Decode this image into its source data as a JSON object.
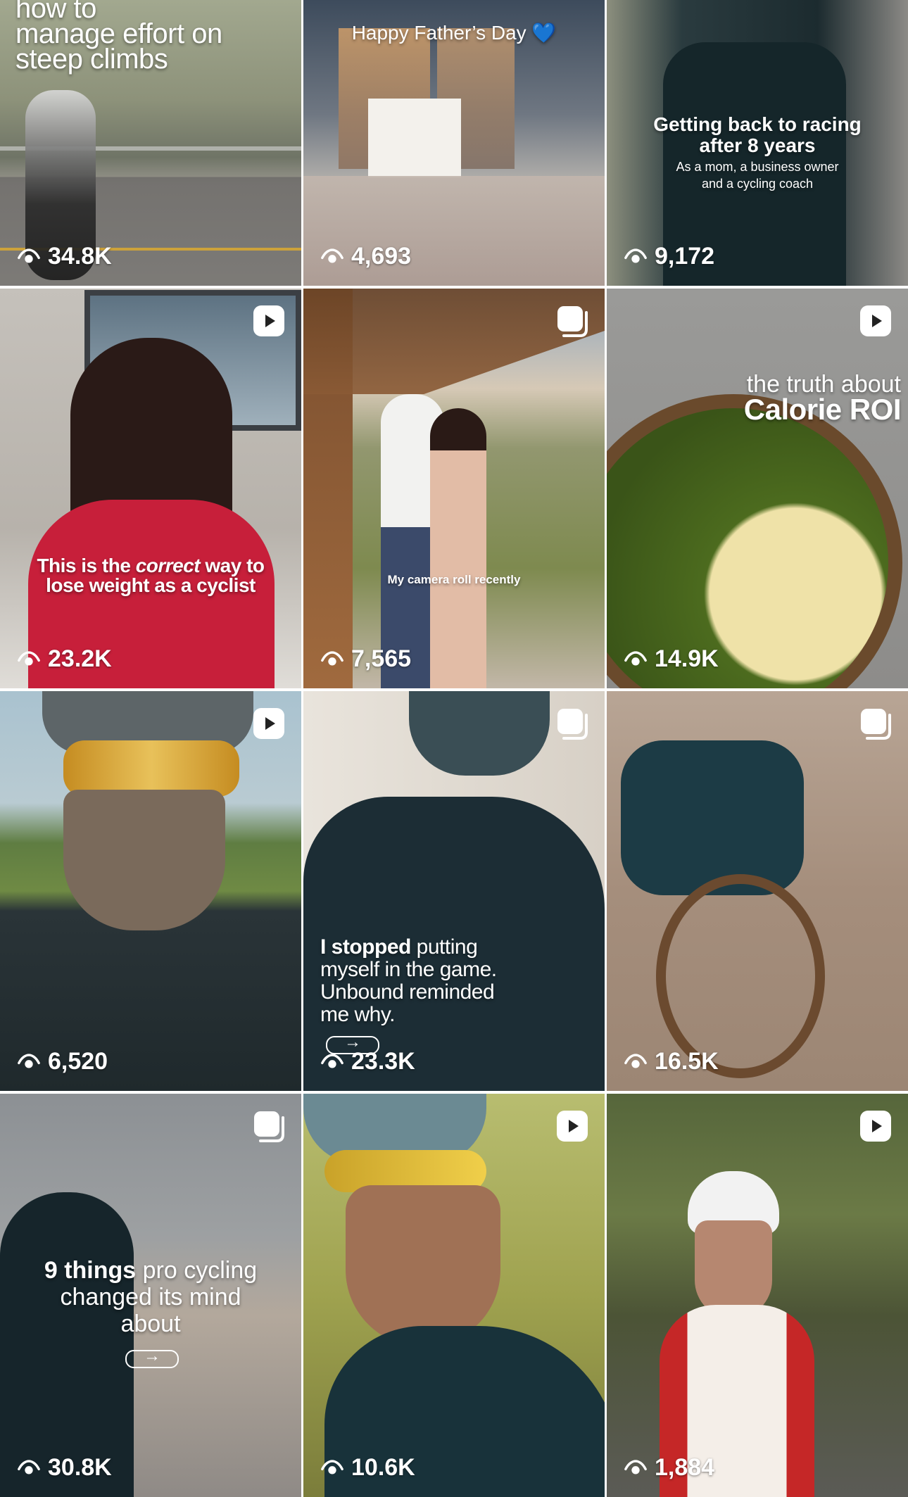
{
  "tiles": [
    {
      "views": "34.8K",
      "caption": {
        "line1": "how to",
        "line2": "manage effort on",
        "line3": "steep climbs"
      },
      "badge": "none"
    },
    {
      "views": "4,693",
      "caption": {
        "text": "Happy Father’s Day 💙"
      },
      "badge": "none"
    },
    {
      "views": "9,172",
      "caption": {
        "line1": "Getting back to racing",
        "line2": "after 8 years",
        "sub1": "As a mom, a business owner",
        "sub2": "and a cycling coach"
      },
      "badge": "none"
    },
    {
      "views": "23.2K",
      "caption": {
        "a": "This is the ",
        "b": "correct",
        "c": " way to",
        "line2": "lose weight as a cyclist"
      },
      "badge": "reel"
    },
    {
      "views": "7,565",
      "caption": {
        "text": "My camera roll recently"
      },
      "badge": "carousel"
    },
    {
      "views": "14.9K",
      "caption": {
        "line1": "the truth about",
        "line2": "Calorie ROI"
      },
      "badge": "reel"
    },
    {
      "views": "6,520",
      "badge": "reel"
    },
    {
      "views": "23.3K",
      "caption": {
        "bold": "I stopped",
        "rest": " putting",
        "line2": "myself in the game.",
        "line3": "Unbound reminded",
        "line4": "me why."
      },
      "badge": "carousel"
    },
    {
      "views": "16.5K",
      "badge": "carousel"
    },
    {
      "views": "30.8K",
      "caption": {
        "bold": "9 things",
        "rest": " pro cycling",
        "line2": "changed its mind",
        "line3": "about"
      },
      "badge": "carousel"
    },
    {
      "views": "10.6K",
      "badge": "reel"
    },
    {
      "views": "1,884",
      "badge": "reel"
    }
  ],
  "icons": {
    "views": "eye-icon",
    "reel": "reel-icon",
    "carousel": "carousel-icon",
    "arrow": "arrow-right-icon"
  },
  "colors": {
    "overlay_text": "#ffffff"
  }
}
